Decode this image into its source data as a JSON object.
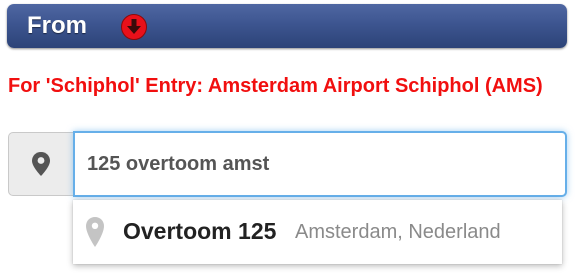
{
  "header": {
    "title": "From",
    "badge_icon": "red-down-arrow-icon",
    "badge_color": "#e8101a",
    "bar_color": "#3d5590"
  },
  "hint": {
    "text": "For 'Schiphol' Entry: Amsterdam Airport Schiphol (AMS)",
    "color": "#f10f0f"
  },
  "search": {
    "icon": "map-marker-icon",
    "value": "125 overtoom amst",
    "focus_color": "#66afe9"
  },
  "suggestions": [
    {
      "icon": "map-marker-icon",
      "main": "Overtoom 125",
      "secondary": "Amsterdam, Nederland"
    }
  ]
}
